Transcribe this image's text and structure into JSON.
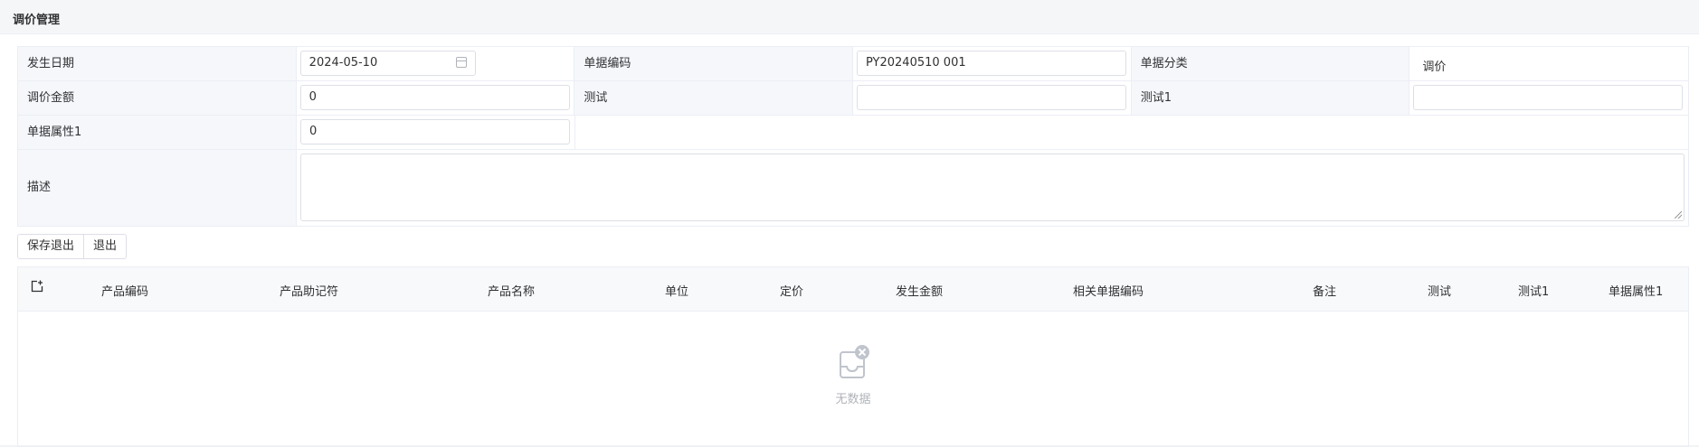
{
  "page": {
    "title": "调价管理"
  },
  "form": {
    "occur_date_label": "发生日期",
    "occur_date_value": "2024-05-10",
    "doc_code_label": "单据编码",
    "doc_code_value": "PY20240510 001",
    "doc_category_label": "单据分类",
    "doc_category_value": "调价",
    "adjust_amount_label": "调价金额",
    "adjust_amount_value": "0",
    "test_label": "测试",
    "test_value": "",
    "test1_label": "测试1",
    "test1_value": "",
    "doc_attr1_label": "单据属性1",
    "doc_attr1_value": "0",
    "description_label": "描述",
    "description_value": ""
  },
  "toolbar": {
    "save_exit_label": "保存退出",
    "exit_label": "退出"
  },
  "table": {
    "columns": [
      "产品编码",
      "产品助记符",
      "产品名称",
      "单位",
      "定价",
      "发生金额",
      "相关单据编码",
      "备注",
      "测试",
      "测试1",
      "单据属性1"
    ],
    "rows": [],
    "empty_text": "无数据"
  },
  "icons": {
    "date": "calendar-icon",
    "add_row": "add-row-icon",
    "empty": "empty-inbox-icon"
  }
}
